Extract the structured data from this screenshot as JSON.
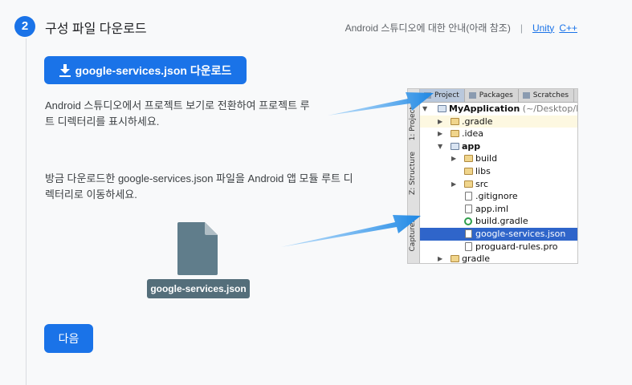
{
  "step": {
    "number": "2",
    "title": "구성 파일 다운로드"
  },
  "help": {
    "text": "Android 스튜디오에 대한 안내(아래 참조)",
    "separator": "|",
    "links": [
      "Unity",
      "C++"
    ]
  },
  "download_button": {
    "label": "google-services.json 다운로드",
    "icon": "download-icon"
  },
  "instructions": [
    "Android 스튜디오에서 프로젝트 보기로 전환하여 프로젝트 루트 디렉터리를 표시하세요.",
    "방금 다운로드한 google-services.json 파일을 Android 앱 모듈 루트 디렉터리로 이동하세요."
  ],
  "file_card": {
    "label": "google-services.json",
    "icon": "file-icon"
  },
  "next_button": {
    "label": "다음"
  },
  "studio": {
    "tabs": [
      "Project",
      "Packages",
      "Scratches"
    ],
    "side_labels": [
      "1: Project",
      "Z: Structure",
      "Captures"
    ],
    "root": {
      "name": "MyApplication",
      "path": "(~/Desktop/My"
    },
    "tree": [
      ".gradle",
      ".idea",
      "app",
      "build",
      "libs",
      "src",
      ".gitignore",
      "app.iml",
      "build.gradle",
      "google-services.json",
      "proguard-rules.pro",
      "gradle"
    ]
  },
  "colors": {
    "accent": "#1a73e8",
    "file_gray": "#546e7a",
    "arrow": "#1e88e5",
    "selection": "#2f65ca"
  }
}
